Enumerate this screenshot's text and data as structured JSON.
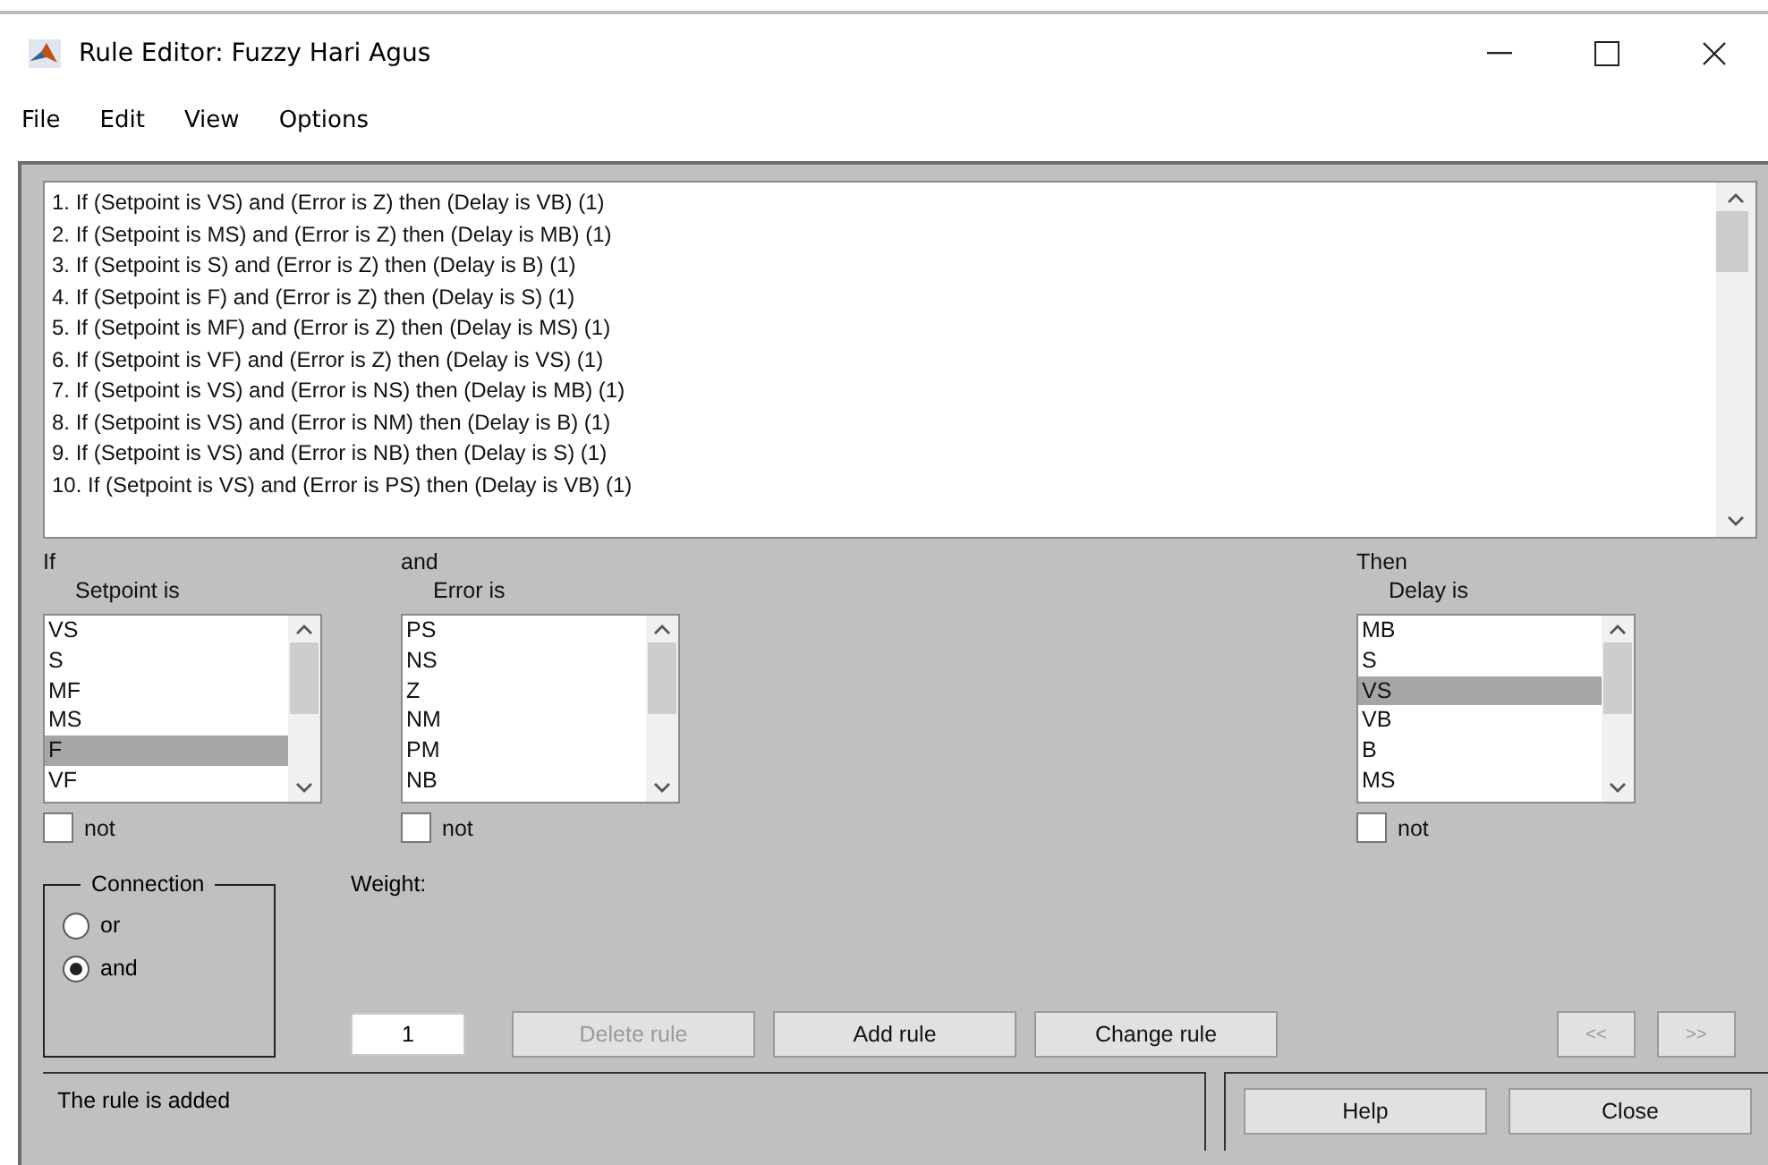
{
  "window": {
    "title": "Rule Editor: Fuzzy Hari Agus"
  },
  "menu": [
    "File",
    "Edit",
    "View",
    "Options"
  ],
  "rules": [
    "1. If (Setpoint is VS) and (Error is Z) then (Delay is VB) (1)",
    "2. If (Setpoint is MS) and (Error is Z) then (Delay is MB) (1)",
    "3. If (Setpoint is S) and (Error is Z) then (Delay is B) (1)",
    "4. If (Setpoint is F) and (Error is Z) then (Delay is S) (1)",
    "5. If (Setpoint is MF) and (Error is Z) then (Delay is MS) (1)",
    "6. If (Setpoint is VF) and (Error is Z) then (Delay is VS) (1)",
    "7. If (Setpoint is VS) and (Error is NS) then (Delay is MB) (1)",
    "8. If (Setpoint is VS) and (Error is NM) then (Delay is B) (1)",
    "9. If (Setpoint is VS) and (Error is NB) then (Delay is S) (1)",
    "10. If (Setpoint is VS) and (Error is PS) then (Delay is VB) (1)"
  ],
  "variables": [
    {
      "connector": "If",
      "label": "Setpoint is",
      "not_label": "not",
      "not": false,
      "items": [
        {
          "label": "VS",
          "selected": false
        },
        {
          "label": "S",
          "selected": false
        },
        {
          "label": "MF",
          "selected": false
        },
        {
          "label": "MS",
          "selected": false
        },
        {
          "label": "F",
          "selected": true
        },
        {
          "label": "VF",
          "selected": false
        }
      ]
    },
    {
      "connector": "and",
      "label": "Error is",
      "not_label": "not",
      "not": false,
      "items": [
        {
          "label": "PS",
          "selected": false
        },
        {
          "label": "NS",
          "selected": false
        },
        {
          "label": "Z",
          "selected": false
        },
        {
          "label": "NM",
          "selected": false
        },
        {
          "label": "PM",
          "selected": false
        },
        {
          "label": "NB",
          "selected": false
        }
      ]
    },
    {
      "connector": "Then",
      "label": "Delay is",
      "not_label": "not",
      "not": false,
      "items": [
        {
          "label": "MB",
          "selected": false
        },
        {
          "label": "S",
          "selected": false
        },
        {
          "label": "VS",
          "selected": true
        },
        {
          "label": "VB",
          "selected": false
        },
        {
          "label": "B",
          "selected": false
        },
        {
          "label": "MS",
          "selected": false
        }
      ]
    }
  ],
  "connection": {
    "title": "Connection",
    "options": [
      {
        "label": "or",
        "selected": false
      },
      {
        "label": "and",
        "selected": true
      }
    ]
  },
  "weight": {
    "label": "Weight:",
    "value": "1"
  },
  "buttons": [
    {
      "label": "Delete rule",
      "disabled": true
    },
    {
      "label": "Add rule",
      "disabled": false
    },
    {
      "label": "Change rule",
      "disabled": false
    }
  ],
  "nav_buttons": [
    {
      "label": "<<",
      "disabled": true
    },
    {
      "label": ">>",
      "disabled": true
    }
  ],
  "status": "The rule is added",
  "footer_buttons": [
    "Help",
    "Close"
  ]
}
